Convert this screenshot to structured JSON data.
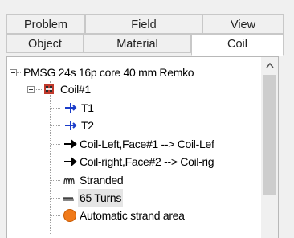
{
  "tabs": {
    "row1": [
      {
        "label": "Problem"
      },
      {
        "label": "Field"
      },
      {
        "label": "View"
      }
    ],
    "row2": [
      {
        "label": "Object"
      },
      {
        "label": "Material"
      },
      {
        "label": "Coil",
        "active": true
      }
    ]
  },
  "tree": {
    "root": {
      "label": "PMSG 24s 16p core 40 mm Remko",
      "expanded": true
    },
    "coil": {
      "label": "Coil#1",
      "icon": "coil-block-icon",
      "expanded": true
    },
    "items": [
      {
        "label": "T1",
        "icon": "blue-cross-arrow-icon"
      },
      {
        "label": "T2",
        "icon": "blue-cross-arrow-icon"
      },
      {
        "label": "Coil-Left,Face#1 --> Coil-Lef",
        "icon": "right-arrow-icon"
      },
      {
        "label": "Coil-right,Face#2 --> Coil-rig",
        "icon": "right-arrow-icon"
      },
      {
        "label": "Stranded",
        "icon": "winding-icon"
      },
      {
        "label": "65 Turns",
        "icon": "turns-icon"
      },
      {
        "label": "Automatic strand area",
        "icon": "orange-circle-icon"
      }
    ]
  },
  "colors": {
    "accent_blue": "#1a3cc9",
    "coil_red": "#c0392b",
    "orange": "#f07a1a",
    "highlight": "#e5e5e5"
  },
  "scrollbar": {
    "up_glyph": "^"
  }
}
